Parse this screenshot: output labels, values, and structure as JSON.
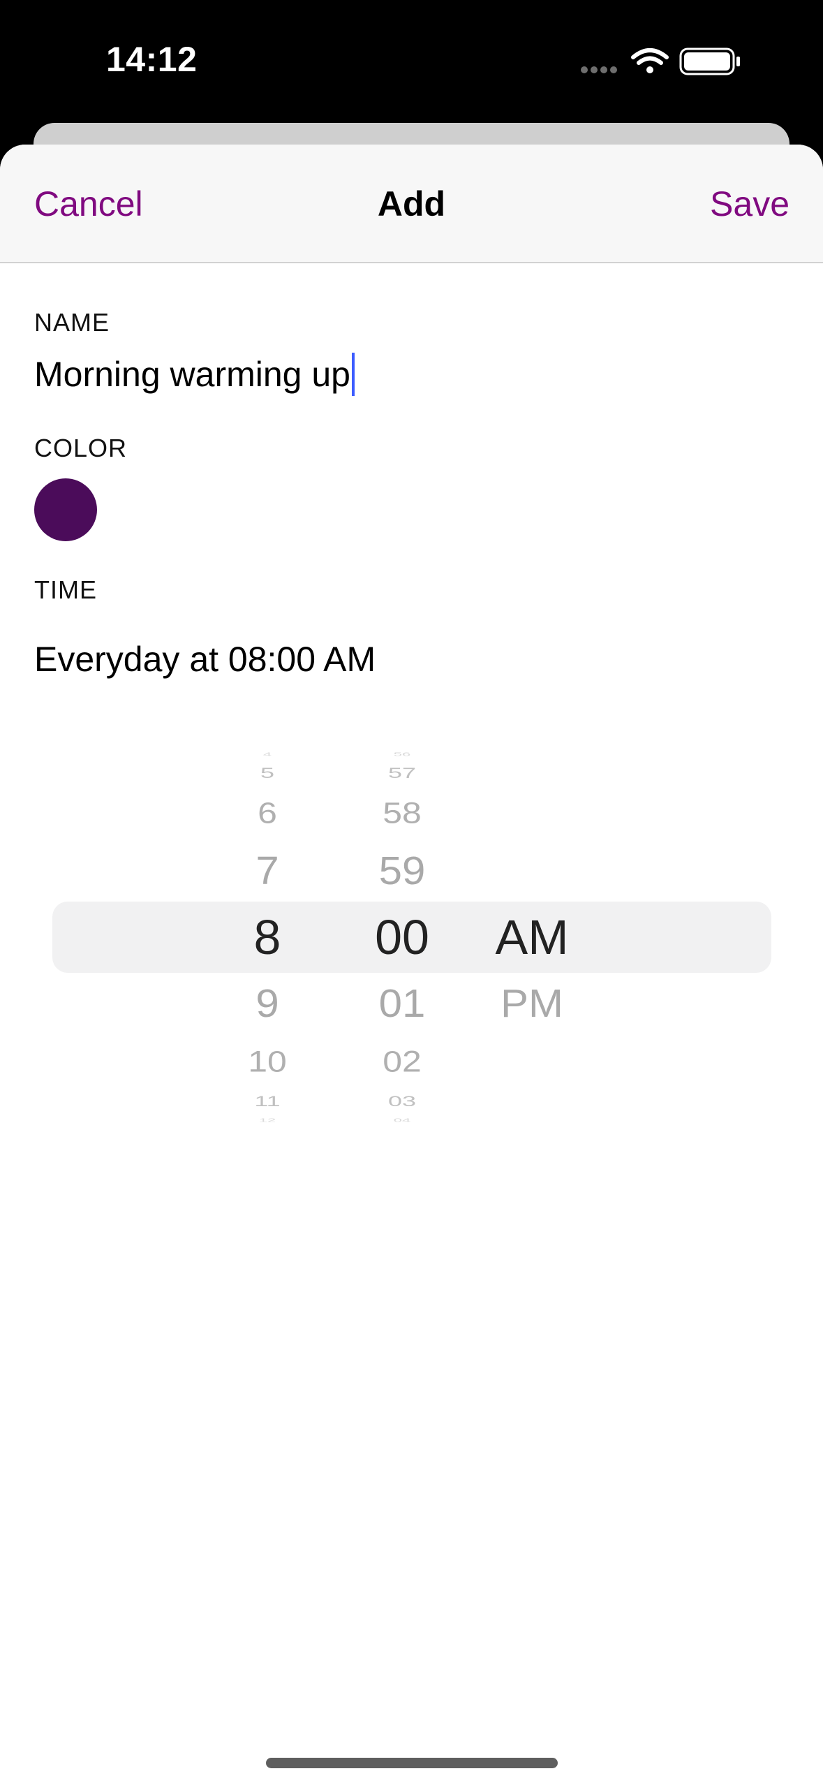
{
  "status_bar": {
    "time": "14:12",
    "icons": [
      "cellular-dots-icon",
      "wifi-icon",
      "battery-icon"
    ]
  },
  "nav": {
    "cancel_label": "Cancel",
    "title": "Add",
    "save_label": "Save"
  },
  "form": {
    "name_label": "NAME",
    "name_value": "Morning warming up",
    "color_label": "COLOR",
    "color_value": "#4b0c5a",
    "time_label": "TIME",
    "time_summary": "Everyday at 08:00 AM"
  },
  "picker": {
    "hours": [
      "4",
      "5",
      "6",
      "7",
      "8",
      "9",
      "10",
      "11",
      "12"
    ],
    "minutes": [
      "56",
      "57",
      "58",
      "59",
      "00",
      "01",
      "02",
      "03",
      "04"
    ],
    "periods": [
      "AM",
      "PM"
    ],
    "selected_hour": "8",
    "selected_minute": "00",
    "selected_period": "AM"
  },
  "colors": {
    "accent": "#800a80",
    "caret": "#3c5cff"
  }
}
